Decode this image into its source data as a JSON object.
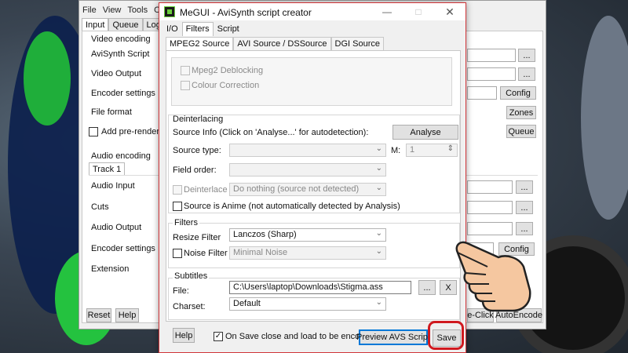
{
  "main_window": {
    "menu": [
      "File",
      "View",
      "Tools",
      "Op"
    ],
    "tabs": [
      "Input",
      "Queue",
      "Log"
    ],
    "video_section": "Video encoding",
    "rows": [
      "AviSynth Script",
      "Video Output",
      "Encoder settings",
      "File format",
      "Add pre-rendering j"
    ],
    "audio_section": "Audio encoding",
    "track_tab": "Track 1",
    "audio_rows": [
      "Audio Input",
      "Cuts",
      "Audio Output",
      "Encoder settings",
      "Extension"
    ],
    "browse": "...",
    "config": "Config",
    "zones": "Zones",
    "queue": "Queue",
    "config2": "Config",
    "reset": "Reset",
    "help": "Help",
    "oneclick": "e-Click",
    "autoencode": "AutoEncode"
  },
  "dialog": {
    "title": "MeGUI - AviSynth script creator",
    "tabs": [
      "I/O",
      "Filters",
      "Script"
    ],
    "subtabs": [
      "MPEG2 Source",
      "AVI Source / DSSource",
      "DGI Source"
    ],
    "mpeg2": {
      "deblocking": "Mpeg2 Deblocking",
      "colour": "Colour Correction"
    },
    "deinterlacing": {
      "legend": "Deinterlacing",
      "source_info": "Source Info (Click on 'Analyse...' for autodetection):",
      "analyse": "Analyse",
      "source_type": "Source type:",
      "m_label": "M:",
      "m_value": "1",
      "field_order": "Field order:",
      "deinterlace": "Deinterlace",
      "deinterlace_value": "Do nothing (source not detected)",
      "anime": "Source is Anime (not automatically detected by Analysis)"
    },
    "filters": {
      "legend": "Filters",
      "resize_label": "Resize Filter",
      "resize_value": "Lanczos (Sharp)",
      "noise_label": "Noise Filter",
      "noise_value": "Minimal Noise"
    },
    "subtitles": {
      "legend": "Subtitles",
      "file_label": "File:",
      "file_value": "C:\\Users\\laptop\\Downloads\\Stigma.ass",
      "browse": "...",
      "clear": "X",
      "charset_label": "Charset:",
      "charset_value": "Default"
    },
    "help": "Help",
    "on_save": "On Save close and load to be encoded",
    "preview": "Preview AVS Script",
    "save": "Save"
  },
  "colors": {
    "accent": "#d0191f",
    "dialog_border": "#d13438",
    "preview_border": "#0078d7"
  }
}
